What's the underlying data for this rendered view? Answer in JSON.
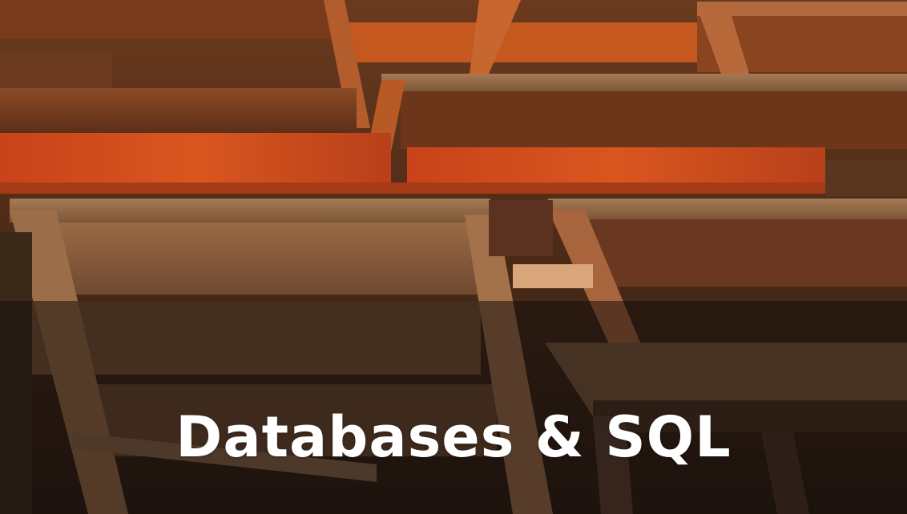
{
  "banner": {
    "title": "Databases & SQL",
    "background_image": "wooden-tables-and-benches-photo",
    "title_color": "#ffffff",
    "overlay_color": "#120e0c"
  }
}
